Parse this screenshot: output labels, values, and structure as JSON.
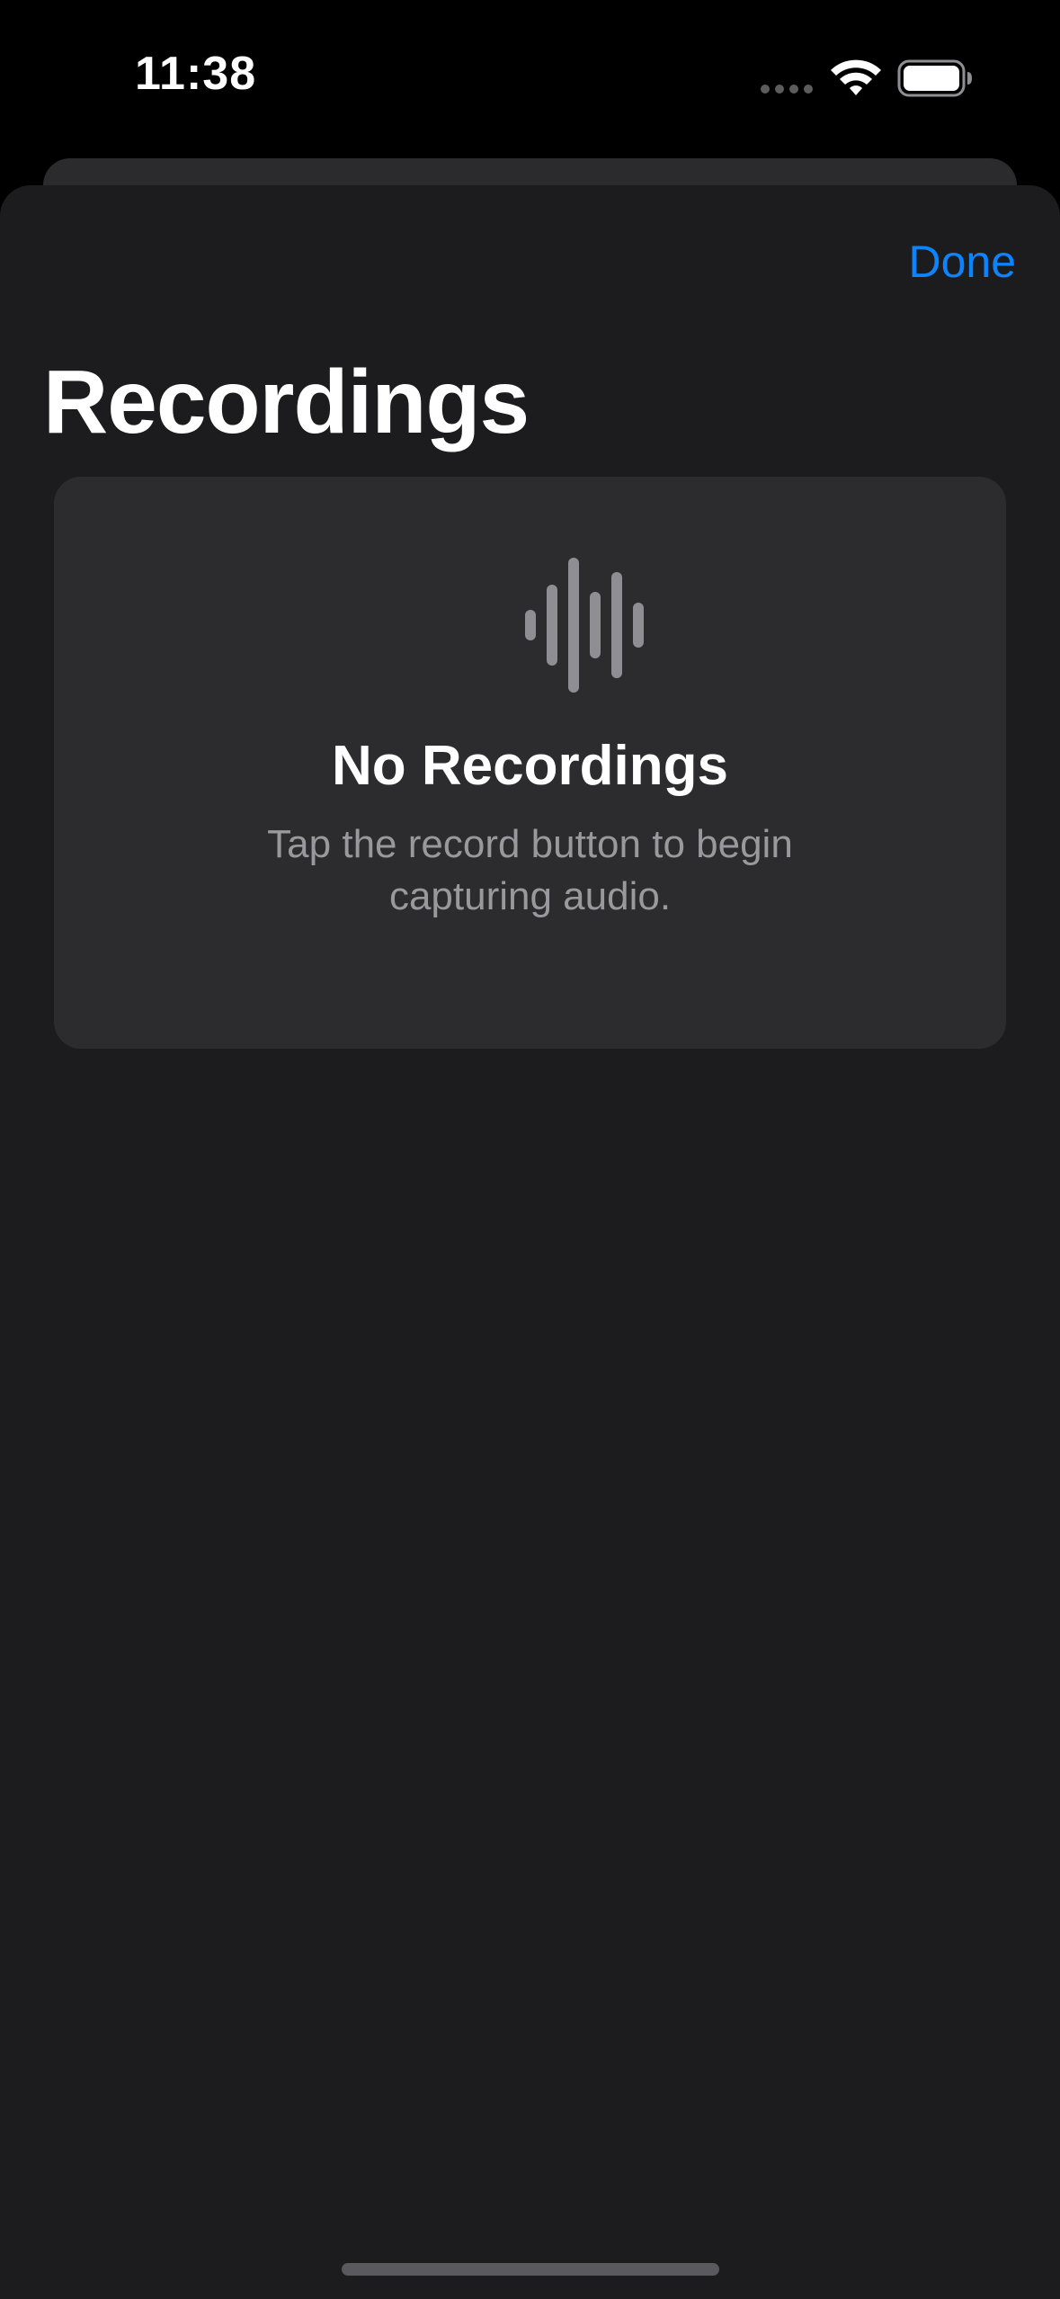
{
  "status_bar": {
    "time": "11:38",
    "icons": [
      "cellular-dots-icon",
      "wifi-icon",
      "battery-icon"
    ]
  },
  "nav": {
    "done_label": "Done"
  },
  "header": {
    "title": "Recordings"
  },
  "empty_state": {
    "icon": "waveform-icon",
    "title": "No Recordings",
    "message": "Tap the record button to begin capturing audio."
  },
  "colors": {
    "accent": "#0a84ff",
    "background": "#1c1c1e",
    "card": "#2c2c2e",
    "secondary_text": "#98989d"
  }
}
